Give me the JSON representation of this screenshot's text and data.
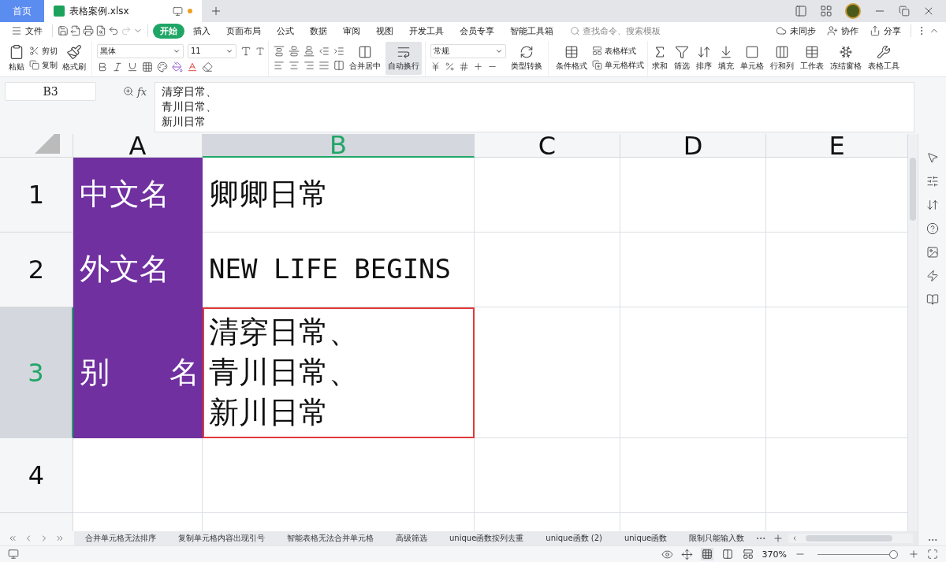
{
  "title_bar": {
    "tabs": [
      {
        "label": "首页",
        "kind": "home",
        "selected": false
      },
      {
        "label": "表格案例.xlsx",
        "kind": "file",
        "selected": true
      }
    ]
  },
  "menu": {
    "file": "文件",
    "tabs": [
      {
        "label": "开始",
        "selected": true
      },
      {
        "label": "插入",
        "selected": false
      },
      {
        "label": "页面布局",
        "selected": false
      },
      {
        "label": "公式",
        "selected": false
      },
      {
        "label": "数据",
        "selected": false
      },
      {
        "label": "审阅",
        "selected": false
      },
      {
        "label": "视图",
        "selected": false
      },
      {
        "label": "开发工具",
        "selected": false
      },
      {
        "label": "会员专享",
        "selected": false
      },
      {
        "label": "智能工具箱",
        "selected": false
      }
    ],
    "search": {
      "placeholder": "查找命令、搜索模板"
    },
    "actions": [
      "未同步",
      "协作",
      "分享"
    ]
  },
  "ribbon": {
    "clipboard": [
      "粘贴",
      "剪切",
      "复制",
      "格式刷"
    ],
    "font": "黑体",
    "font_size": "11",
    "merge": "合并居中",
    "wrap": {
      "label": "自动换行",
      "on": true
    },
    "number_format": "常规",
    "convert": "类型转换",
    "styles": [
      "条件格式",
      "表格样式",
      "单元格样式"
    ],
    "tools": [
      "求和",
      "筛选",
      "排序",
      "填充",
      "单元格",
      "行和列",
      "工作表",
      "冻结窗格",
      "表格工具"
    ]
  },
  "formula_bar": {
    "cell_ref": "B3",
    "fx": "fx",
    "lines": [
      "清穿日常、",
      "青川日常、",
      "新川日常"
    ]
  },
  "grid": {
    "columns": [
      {
        "label": "A",
        "selected": false
      },
      {
        "label": "B",
        "selected": true
      },
      {
        "label": "C",
        "selected": false
      },
      {
        "label": "D",
        "selected": false
      },
      {
        "label": "E",
        "selected": false
      }
    ],
    "rows": [
      {
        "label": "1",
        "selected": false,
        "cells": [
          {
            "kind": "label",
            "text": "中文名",
            "selected": false
          },
          {
            "kind": "text",
            "lines": [
              "卿卿日常"
            ],
            "selected": false
          }
        ]
      },
      {
        "label": "2",
        "selected": false,
        "cells": [
          {
            "kind": "label",
            "text": "外文名",
            "selected": false
          },
          {
            "kind": "text",
            "lines": [
              "NEW LIFE BEGINS"
            ],
            "selected": false
          }
        ]
      },
      {
        "label": "3",
        "selected": true,
        "cells": [
          {
            "kind": "label",
            "text": "别　　名",
            "selected": false
          },
          {
            "kind": "text",
            "lines": [
              "清穿日常、",
              "青川日常、",
              "新川日常"
            ],
            "selected": true
          }
        ]
      },
      {
        "label": "4",
        "selected": false,
        "cells": []
      }
    ]
  },
  "sheet_tabs": [
    "合并单元格无法排序",
    "复制单元格内容出现引号",
    "智能表格无法合并单元格",
    "高级筛选",
    "unique函数按列去重",
    "unique函数 (2)",
    "unique函数",
    "限制只能输入数"
  ],
  "status_bar": {
    "zoom": "370%",
    "zoom_slider": {
      "level": 0.97
    }
  }
}
